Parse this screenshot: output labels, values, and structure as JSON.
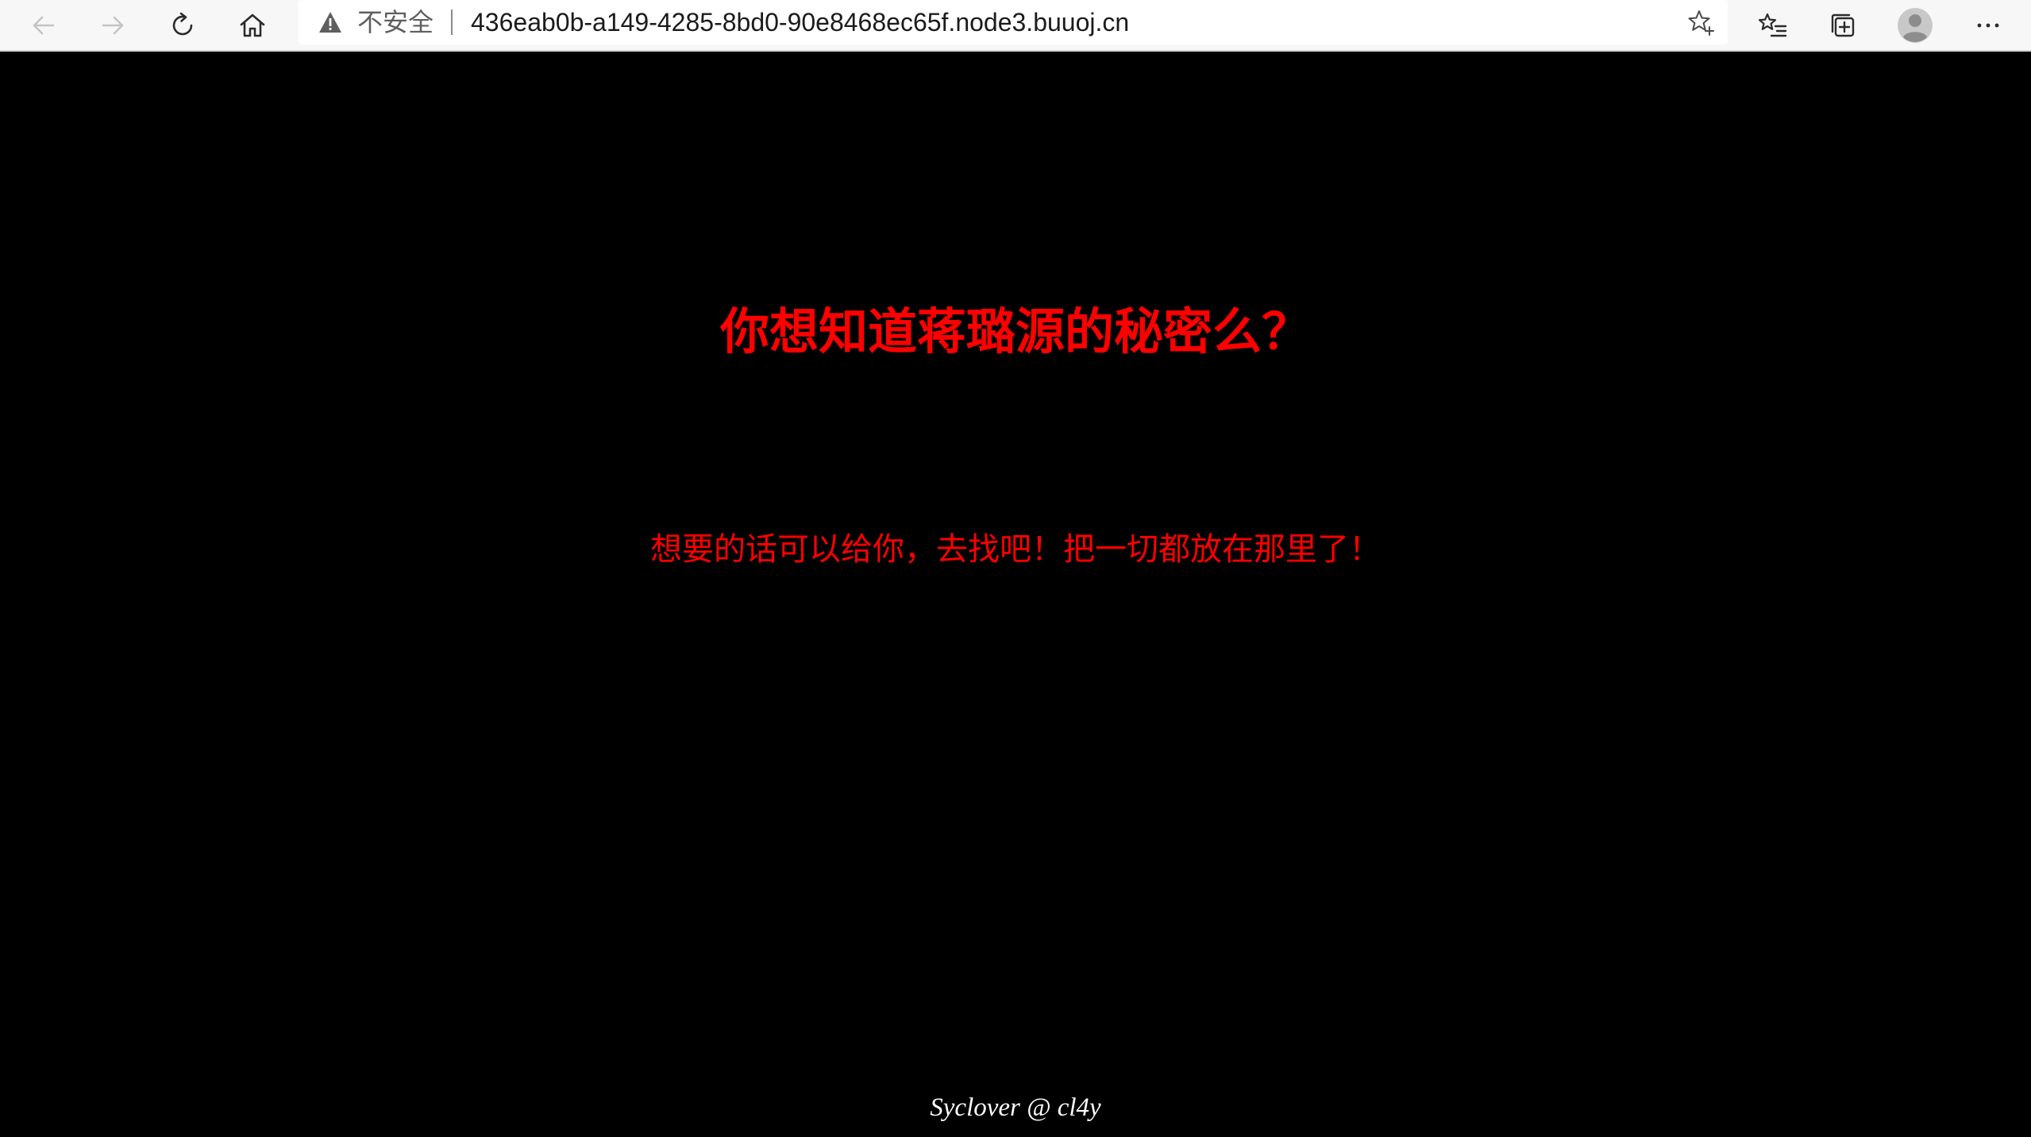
{
  "browser": {
    "nav": {
      "back_icon": "arrow-left-icon",
      "forward_icon": "arrow-right-icon",
      "refresh_icon": "refresh-icon",
      "home_icon": "home-icon"
    },
    "addressbar": {
      "security_icon": "warning-triangle-icon",
      "security_label": "不安全",
      "url": "436eab0b-a149-4285-8bd0-90e8468ec65f.node3.buuoj.cn",
      "favorite_icon": "star-add-icon"
    },
    "right_icons": [
      "favorites-list-icon",
      "collections-icon",
      "profile-avatar-icon",
      "more-options-icon"
    ]
  },
  "page": {
    "headline": "你想知道蒋璐源的秘密么？",
    "subline": "想要的话可以给你，去找吧！把一切都放在那里了！",
    "footer": "Syclover @ cl4y"
  },
  "colors": {
    "background": "#000000",
    "text_accent": "#ff0000",
    "footer_text": "#ffffff",
    "toolbar": "#f7f7f7"
  }
}
